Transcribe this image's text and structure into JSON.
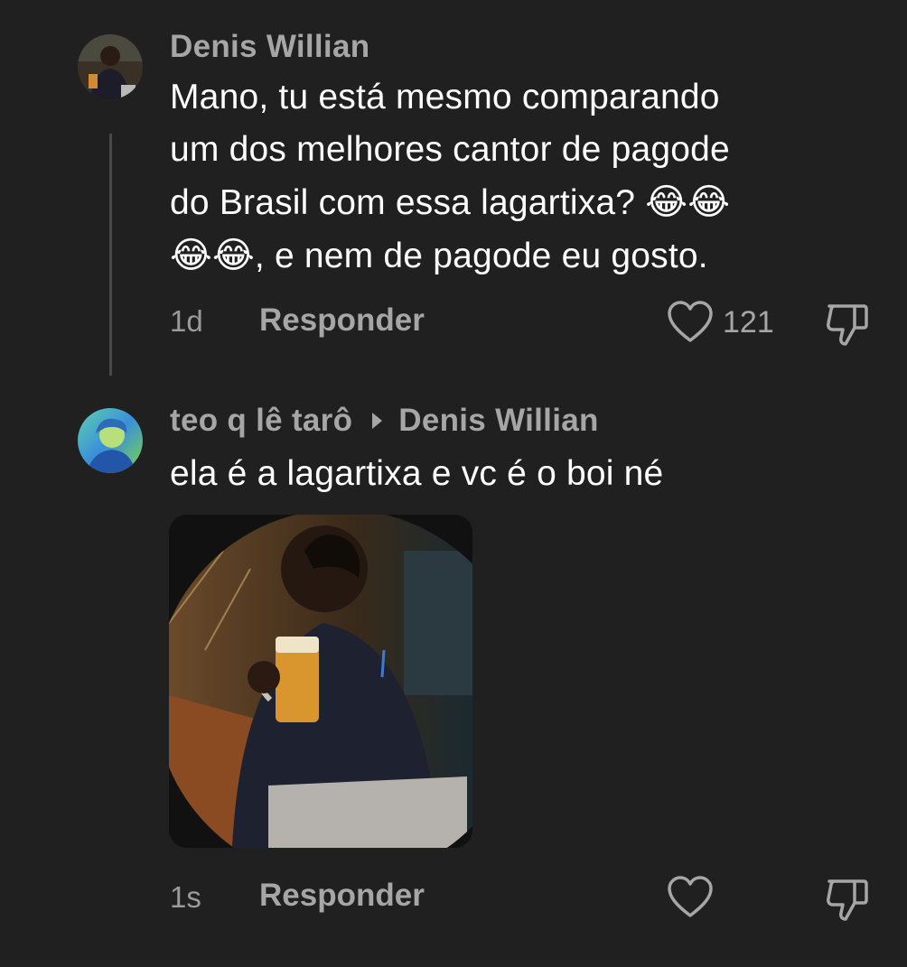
{
  "comments": [
    {
      "author": "Denis Willian",
      "text_line1": "Mano, tu está mesmo comparando",
      "text_line2": "um dos melhores cantor de pagode",
      "text_line3": "do Brasil com essa lagartixa? ",
      "text_emoji1": "😂😂",
      "text_emoji2": "😂😂",
      "text_line4": ", e nem de pagode eu gosto.",
      "time": "1d",
      "reply_label": "Responder",
      "likes": "121",
      "avatar_icon": "user-avatar-photo"
    },
    {
      "author": "teo q lê tarô",
      "replying_to": "Denis Willian",
      "text": "ela é a lagartixa e vc é o boi né",
      "time": "1s",
      "reply_label": "Responder",
      "avatar_icon": "user-avatar-photo",
      "attachment_icon": "attached-photo"
    }
  ],
  "colors": {
    "background": "#202020",
    "primary_text": "#ffffff",
    "secondary_text": "#a6a6a6",
    "thread_line": "#4a4a4a"
  }
}
